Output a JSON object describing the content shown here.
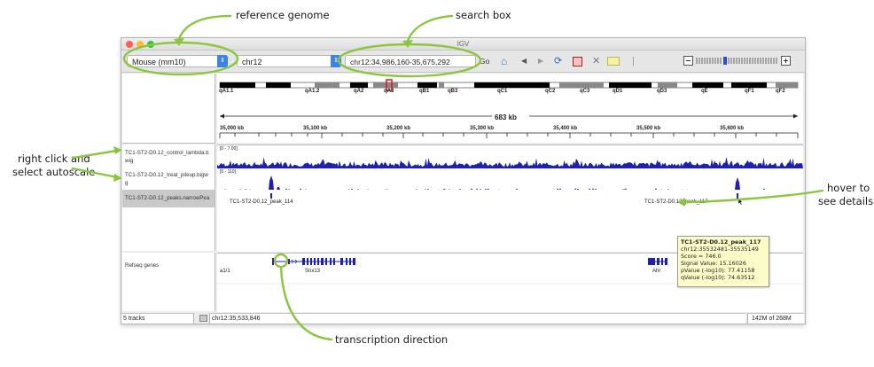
{
  "annotations": {
    "reference_genome": "reference genome",
    "search_box": "search box",
    "right_click": "right click and",
    "select_autoscale": "select autoscale",
    "hover_to": "hover to",
    "see_details": "see details",
    "transcription_direction": "transcription direction"
  },
  "window": {
    "title": "IGV",
    "colors": {
      "accent": "#3b83e6",
      "track": "#1f1fb4",
      "annotation": "#8cc63f",
      "tooltip": "#fcfcc8"
    }
  },
  "toolbar": {
    "genome": "Mouse (mm10)",
    "chromosome": "chr12",
    "locus": "chr12:34,986,160-35,675,292",
    "go": "Go",
    "icons": [
      "home-icon",
      "back-icon",
      "forward-icon",
      "refresh-icon",
      "roi-icon",
      "clear-icon",
      "popup-text-icon"
    ]
  },
  "ideogram": {
    "bands": [
      "qA1.1",
      "qA1.2",
      "qA2",
      "qA3",
      "qB1",
      "qB3",
      "qC1",
      "qC2",
      "qC3",
      "qD1",
      "qD3",
      "qE",
      "qF1",
      "qF2"
    ]
  },
  "ruler": {
    "span": "683 kb",
    "ticks": [
      "35,000 kb",
      "35,100 kb",
      "35,200 kb",
      "35,300 kb",
      "35,400 kb",
      "35,500 kb",
      "35,600 kb"
    ]
  },
  "tracks": {
    "control_name_1": "TC1-ST2-D0.12_control_lambda.b",
    "control_name_2": "wig",
    "control_range": "[0 - 7.00]",
    "treat_name_1": "TC1-ST2-D0.12_treat_pileup.bigw",
    "treat_name_2": "g",
    "treat_range": "[0 - 110]",
    "peaks_name": "TC1-ST2-D0.12_peaks.narrowPea",
    "peak_left": "TC1-ST2-D0.12_peak_114",
    "peak_right": "TC1-ST2-D0.12_peak_117",
    "refseq_name": "Refseq genes",
    "gene_left_partial": "a1/1",
    "gene_snx13": "Snx13",
    "gene_ahr": "Ahr"
  },
  "tooltip": {
    "title": "TC1-ST2-D0.12_peak_117",
    "location": "chr12:35532481-35535149",
    "score": "Score = 746.0",
    "signal": "Signal Value: 15.16026",
    "pvalue": "pValue (-log10): 77.41158",
    "qvalue": "qValue (-log10): 74.63512"
  },
  "status": {
    "tracks": "5 tracks",
    "position": "chr12:35,533,846",
    "memory": "142M of 268M"
  }
}
